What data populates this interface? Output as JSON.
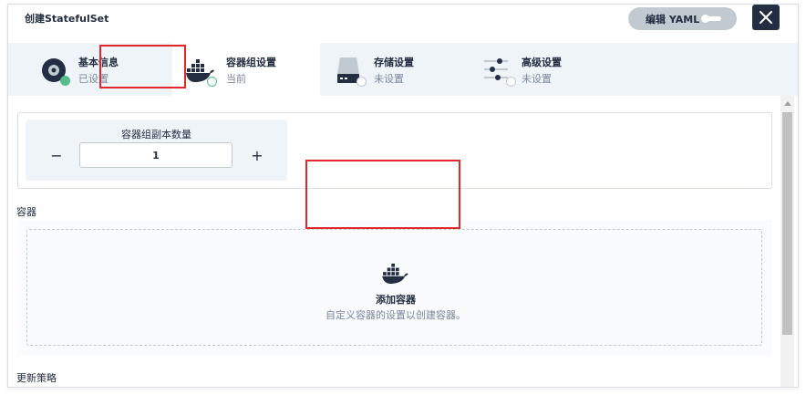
{
  "dialog": {
    "title": "创建StatefulSet",
    "yaml_label": "编辑 YAML"
  },
  "tabs": [
    {
      "name": "基本信息",
      "status": "已设置",
      "icon": "info-disc-icon"
    },
    {
      "name": "容器组设置",
      "status": "当前",
      "icon": "docker-whale-icon"
    },
    {
      "name": "存储设置",
      "status": "未设置",
      "icon": "storage-drive-icon"
    },
    {
      "name": "高级设置",
      "status": "未设置",
      "icon": "sliders-icon"
    }
  ],
  "replicas": {
    "label": "容器组副本数量",
    "value": "1"
  },
  "containers": {
    "section_label": "容器",
    "add_title": "添加容器",
    "add_desc": "自定义容器的设置以创建容器。"
  },
  "update_strategy": {
    "section_label": "更新策略"
  },
  "colors": {
    "accent_green": "#55bc8a",
    "dark": "#242e42",
    "highlight_red": "#e0272c"
  }
}
